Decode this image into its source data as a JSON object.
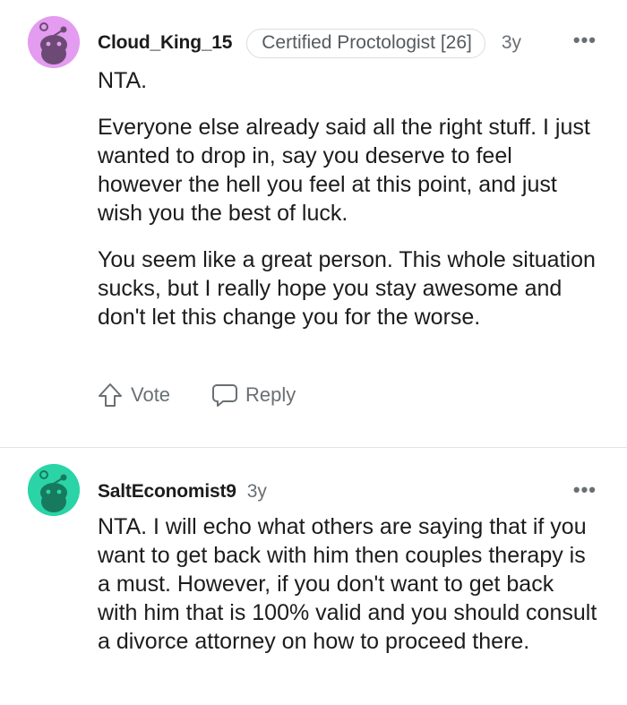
{
  "comments": [
    {
      "username": "Cloud_King_15",
      "flair": "Certified Proctologist [26]",
      "age": "3y",
      "more": "•••",
      "paragraphs": [
        "NTA.",
        "Everyone else already said all the right stuff. I just wanted to drop in, say you deserve to feel however the hell you feel at this point, and just wish you the best of luck.",
        "You seem like a great person. This whole situation sucks, but I really hope you stay awesome and don't let this change you for the worse."
      ],
      "actions": {
        "vote": "Vote",
        "reply": "Reply"
      },
      "avatar_color": "#e39cf0"
    },
    {
      "username": "SaltEconomist9",
      "age": "3y",
      "more": "•••",
      "paragraphs": [
        "NTA. I will echo what others are saying that if you want to get back with him then couples therapy is a must. However, if you don't want to get back with him that is 100% valid and you should consult a divorce attorney on how to proceed there."
      ],
      "avatar_color": "#2ad4a6"
    }
  ],
  "icons": {
    "avatar": "snoo-avatar-icon",
    "vote": "upvote-arrow-icon",
    "reply": "speech-bubble-icon",
    "more": "more-options-icon"
  }
}
